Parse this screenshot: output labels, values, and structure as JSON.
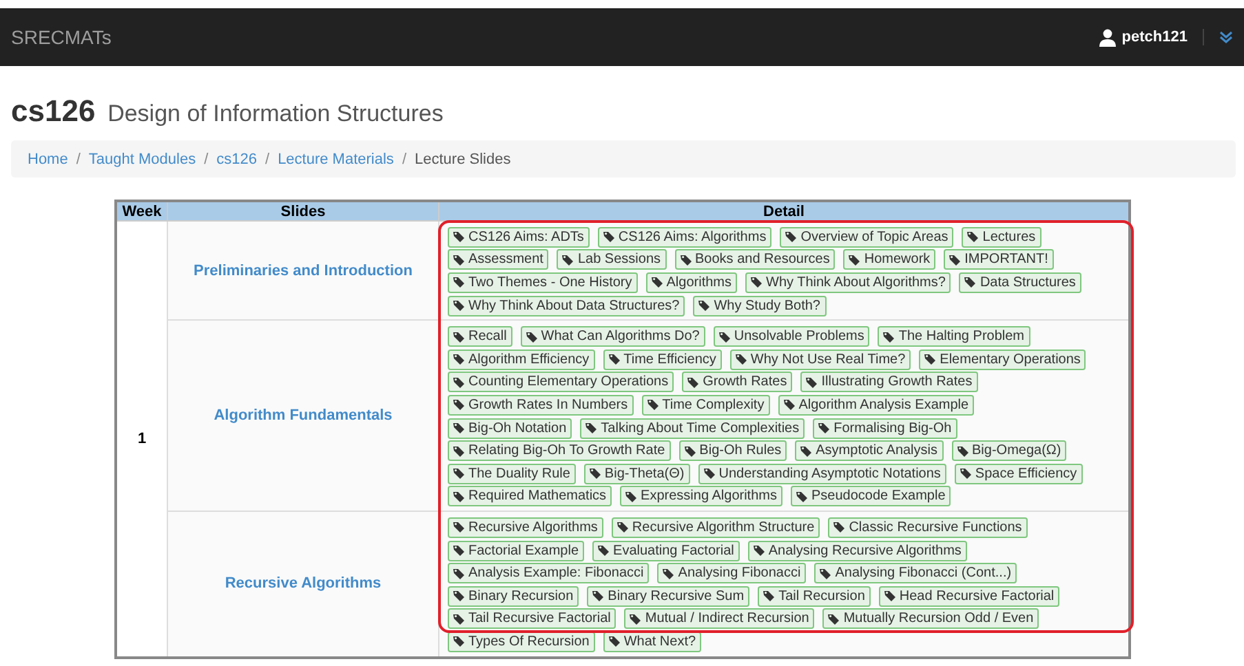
{
  "navbar": {
    "brand": "SRECMATs",
    "user": "petch121"
  },
  "header": {
    "code": "cs126",
    "title": "Design of Information Structures"
  },
  "breadcrumb": [
    {
      "label": "Home",
      "link": true
    },
    {
      "separator": "/",
      "label": "Taught Modules",
      "link": true
    },
    {
      "separator": "/",
      "label": "cs126",
      "link": true
    },
    {
      "separator": "/",
      "label": "Lecture Materials",
      "link": true
    },
    {
      "separator": "/",
      "label": "Lecture Slides",
      "link": false
    }
  ],
  "table": {
    "columns": [
      "Week",
      "Slides",
      "Detail"
    ],
    "week": "1",
    "highlighted": true,
    "rows": [
      {
        "slides": "Preliminaries and Introduction",
        "tag_lines": [
          [
            "CS126 Aims: ADTs",
            "CS126 Aims: Algorithms",
            "Overview of Topic Areas",
            "Lectures"
          ],
          [
            "Assessment",
            "Lab Sessions",
            "Books and Resources",
            "Homework",
            "IMPORTANT!"
          ],
          [
            "Two Themes - One History",
            "Algorithms",
            "Why Think About Algorithms?",
            "Data Structures"
          ],
          [
            "Why Think About Data Structures?",
            "Why Study Both?"
          ]
        ]
      },
      {
        "slides": "Algorithm Fundamentals",
        "tag_lines": [
          [
            "Recall",
            "What Can Algorithms Do?",
            "Unsolvable Problems",
            "The Halting Problem"
          ],
          [
            "Algorithm Efficiency",
            "Time Efficiency",
            "Why Not Use Real Time?",
            "Elementary Operations"
          ],
          [
            "Counting Elementary Operations",
            "Growth Rates",
            "Illustrating Growth Rates"
          ],
          [
            "Growth Rates In Numbers",
            "Time Complexity",
            "Algorithm Analysis Example"
          ],
          [
            "Big-Oh Notation",
            "Talking About Time Complexities",
            "Formalising Big-Oh"
          ],
          [
            "Relating Big-Oh To Growth Rate",
            "Big-Oh Rules",
            "Asymptotic Analysis",
            "Big-Omega(Ω)"
          ],
          [
            "The Duality Rule",
            "Big-Theta(Θ)",
            "Understanding Asymptotic Notations",
            "Space Efficiency"
          ],
          [
            "Required Mathematics",
            "Expressing Algorithms",
            "Pseudocode Example"
          ]
        ]
      },
      {
        "slides": "Recursive Algorithms",
        "tag_lines": [
          [
            "Recursive Algorithms",
            "Recursive Algorithm Structure",
            "Classic Recursive Functions"
          ],
          [
            "Factorial Example",
            "Evaluating Factorial",
            "Analysing Recursive Algorithms"
          ],
          [
            "Analysis Example: Fibonacci",
            "Analysing Fibonacci",
            "Analysing Fibonacci (Cont...)"
          ],
          [
            "Binary Recursion",
            "Binary Recursive Sum",
            "Tail Recursion",
            "Head Recursive Factorial"
          ],
          [
            "Tail Recursive Factorial",
            "Mutual / Indirect Recursion",
            "Mutually Recursion Odd / Even"
          ],
          [
            "Types Of Recursion",
            "What Next?"
          ]
        ]
      }
    ]
  }
}
